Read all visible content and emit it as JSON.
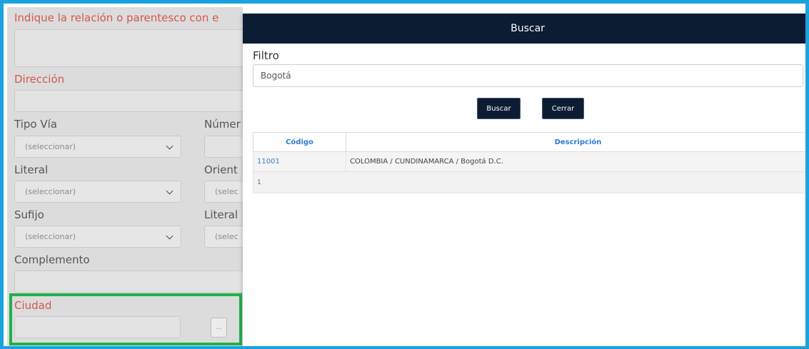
{
  "form": {
    "relation_label": "Indique la relación o parentesco con e",
    "direccion_label": "Dirección",
    "tipo_via_label": "Tipo Vía",
    "numero_label": "Númer",
    "literal_label": "Literal",
    "orient_label": "Orient",
    "sufijo_label": "Sufijo",
    "literal2_label": "Literal",
    "complemento_label": "Complemento",
    "ciudad_label": "Ciudad",
    "select_placeholder": "(seleccionar)",
    "select_cut_placeholder": "(selec",
    "dots_button": "..."
  },
  "modal": {
    "title": "Buscar",
    "filter_label": "Filtro",
    "filter_value": "Bogotá",
    "search_button": "Buscar",
    "close_button": "Cerrar",
    "table": {
      "columns": [
        "Código",
        "Descripción"
      ],
      "rows": [
        {
          "code": "11001",
          "description": "COLOMBIA / CUNDINAMARCA / Bogotá D.C."
        }
      ],
      "pager": "1"
    }
  },
  "colors": {
    "frame": "#1aa3e0",
    "highlight": "#1fb14b",
    "header": "#0c1c33",
    "required_label": "#d2584f",
    "link_blue": "#2a7ccd"
  }
}
